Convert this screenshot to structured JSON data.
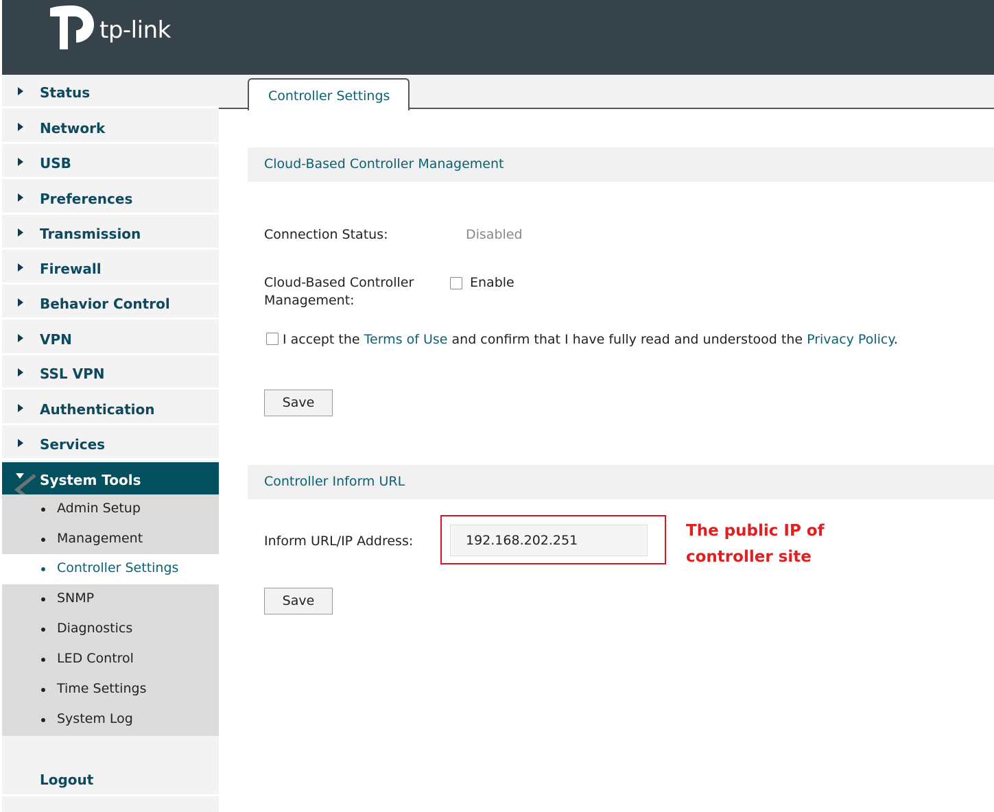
{
  "brand": {
    "logo_text": "tp-link"
  },
  "sidebar": {
    "items": [
      {
        "label": "Status"
      },
      {
        "label": "Network"
      },
      {
        "label": "USB"
      },
      {
        "label": "Preferences"
      },
      {
        "label": "Transmission"
      },
      {
        "label": "Firewall"
      },
      {
        "label": "Behavior Control"
      },
      {
        "label": "VPN"
      },
      {
        "label": "SSL VPN"
      },
      {
        "label": "Authentication"
      },
      {
        "label": "Services"
      },
      {
        "label": "System Tools"
      }
    ],
    "sub_items": [
      {
        "label": "Admin Setup"
      },
      {
        "label": "Management"
      },
      {
        "label": "Controller Settings"
      },
      {
        "label": "SNMP"
      },
      {
        "label": "Diagnostics"
      },
      {
        "label": "LED Control"
      },
      {
        "label": "Time Settings"
      },
      {
        "label": "System Log"
      }
    ],
    "logout": "Logout"
  },
  "tabs": [
    {
      "label": "Controller Settings"
    }
  ],
  "cloud": {
    "section_title": "Cloud-Based Controller Management",
    "status_label": "Connection Status:",
    "status_value": "Disabled",
    "mgmt_label_line1": "Cloud-Based Controller",
    "mgmt_label_line2": "Management:",
    "enable_label": "Enable",
    "accept_prefix": "I accept the ",
    "terms_link": "Terms of Use",
    "accept_middle": " and confirm that I have fully read and understood the ",
    "privacy_link": "Privacy Policy",
    "accept_suffix": ".",
    "save_label": "Save"
  },
  "inform": {
    "section_title": "Controller Inform URL",
    "url_label": "Inform URL/IP Address:",
    "url_value": "192.168.202.251",
    "save_label": "Save"
  },
  "annotation": {
    "line1": "The public IP of",
    "line2": "controller site"
  },
  "colors": {
    "header_bg": "#36434a",
    "accent": "#0b6173",
    "active_nav": "#04505f",
    "annotation_red": "#d9141e"
  }
}
